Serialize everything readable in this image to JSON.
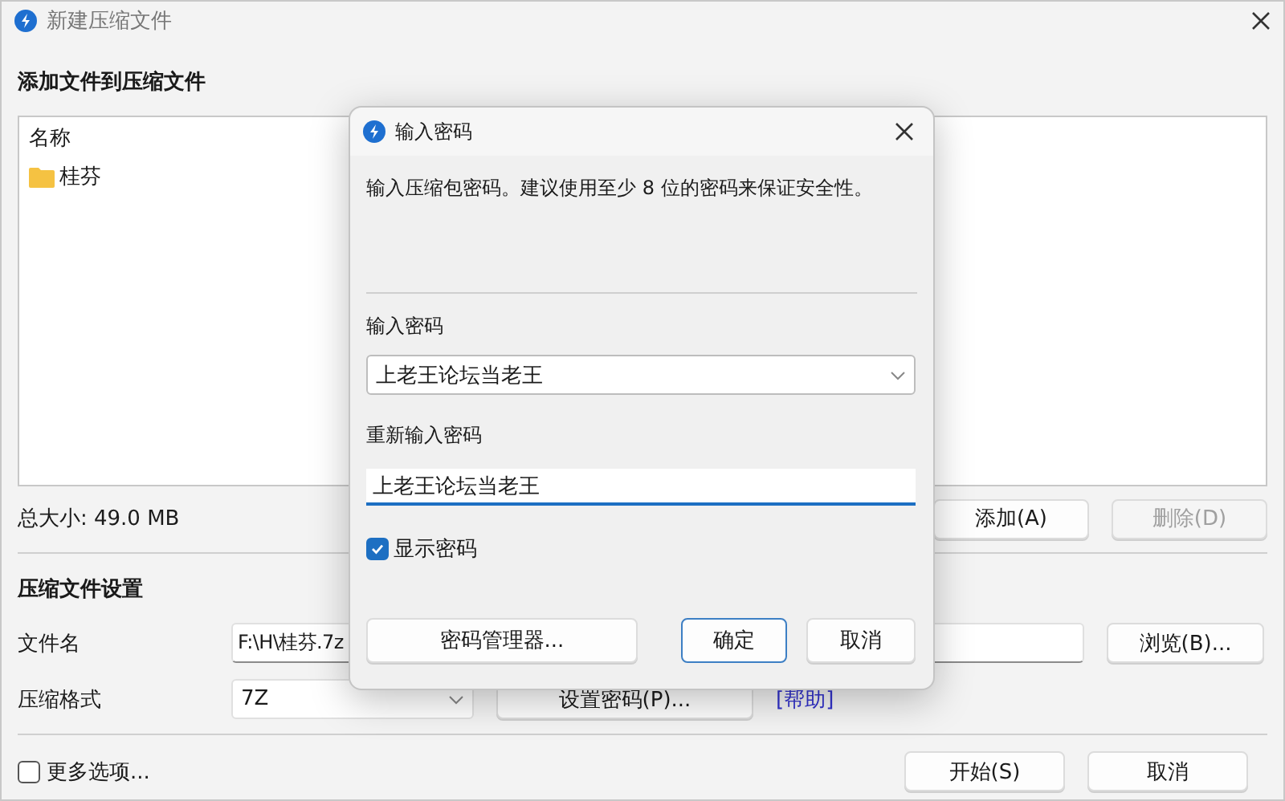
{
  "window": {
    "title": "新建压缩文件"
  },
  "add_section": {
    "heading": "添加文件到压缩文件",
    "file_list": {
      "columns": [
        "名称"
      ],
      "items": [
        {
          "name": "桂芬",
          "kind": "folder"
        }
      ]
    },
    "total_size": "总大小: 49.0 MB",
    "buttons": [
      {
        "label": "添加(A)",
        "disabled": false
      },
      {
        "label": "删除(D)",
        "disabled": true
      }
    ]
  },
  "settings": {
    "heading": "压缩文件设置",
    "filename": {
      "label": "文件名",
      "value": "F:\\H\\桂芬.7z",
      "browse": "浏览(B)..."
    },
    "format": {
      "label": "压缩格式",
      "value": "7Z",
      "set_password": "设置密码(P)...",
      "help": "[帮助]"
    }
  },
  "more_options": {
    "label": "更多选项...",
    "checked": false
  },
  "footer_buttons": [
    "开始(S)",
    "取消"
  ],
  "dialog": {
    "title": "输入密码",
    "description": "输入压缩包密码。建议使用至少 8 位的密码来保证安全性。",
    "password": {
      "label": "输入密码",
      "value": "上老王论坛当老王"
    },
    "confirm": {
      "label": "重新输入密码",
      "value": "上老王论坛当老王"
    },
    "show_password": {
      "label": "显示密码",
      "checked": true
    },
    "buttons": [
      {
        "label": "密码管理器...",
        "default": false
      },
      {
        "label": "确定",
        "default": true
      },
      {
        "label": "取消",
        "default": false
      }
    ]
  }
}
